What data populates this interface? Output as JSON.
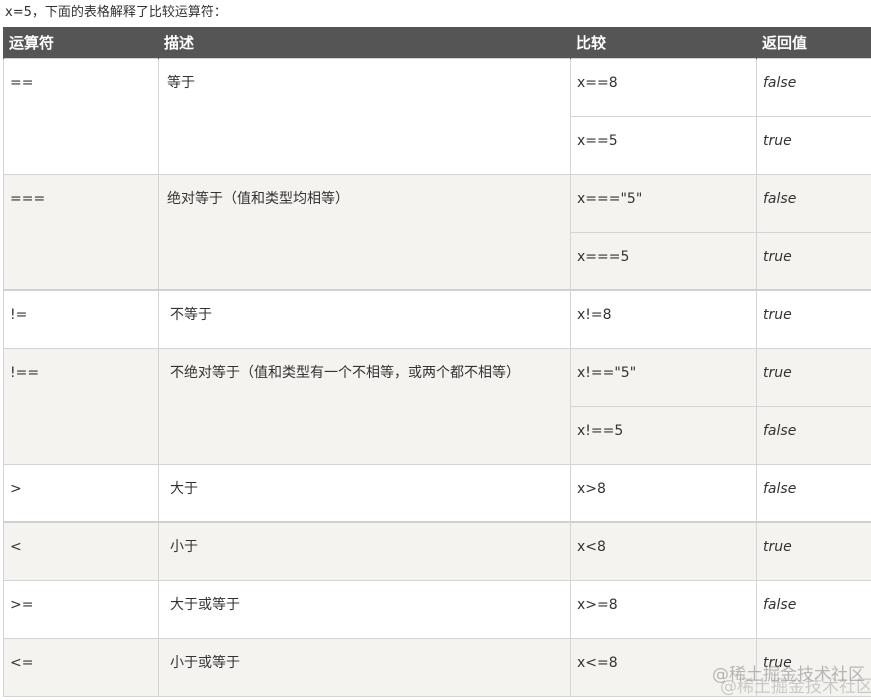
{
  "intro": "x=5，下面的表格解释了比较运算符：",
  "headers": {
    "operator": "运算符",
    "description": "描述",
    "example": "比较",
    "result": "返回值"
  },
  "rows": [
    {
      "operator": "==",
      "description": "等于",
      "examples": [
        {
          "expr": "x==8",
          "result": "false"
        },
        {
          "expr": "x==5",
          "result": "true"
        }
      ]
    },
    {
      "operator": "===",
      "description": "绝对等于（值和类型均相等）",
      "examples": [
        {
          "expr": "x===\"5\"",
          "result": "false"
        },
        {
          "expr": "x===5",
          "result": "true"
        }
      ]
    },
    {
      "operator": "!=",
      "description": "不等于",
      "examples": [
        {
          "expr": "x!=8",
          "result": "true"
        }
      ]
    },
    {
      "operator": "!==",
      "description": "不绝对等于（值和类型有一个不相等，或两个都不相等）",
      "examples": [
        {
          "expr": "x!==\"5\"",
          "result": "true"
        },
        {
          "expr": "x!==5",
          "result": "false"
        }
      ]
    },
    {
      "operator": ">",
      "description": "大于",
      "examples": [
        {
          "expr": "x>8",
          "result": "false"
        }
      ]
    },
    {
      "operator": "<",
      "description": "小于",
      "examples": [
        {
          "expr": "x<8",
          "result": "true"
        }
      ]
    },
    {
      "operator": ">=",
      "description": "大于或等于",
      "examples": [
        {
          "expr": "x>=8",
          "result": "false"
        }
      ]
    },
    {
      "operator": "<=",
      "description": "小于或等于",
      "examples": [
        {
          "expr": "x<=8",
          "result": "true"
        }
      ]
    }
  ],
  "watermark": {
    "line1": "@稀土掘金技术社区",
    "line2": "@稀土掘金技术社区"
  }
}
